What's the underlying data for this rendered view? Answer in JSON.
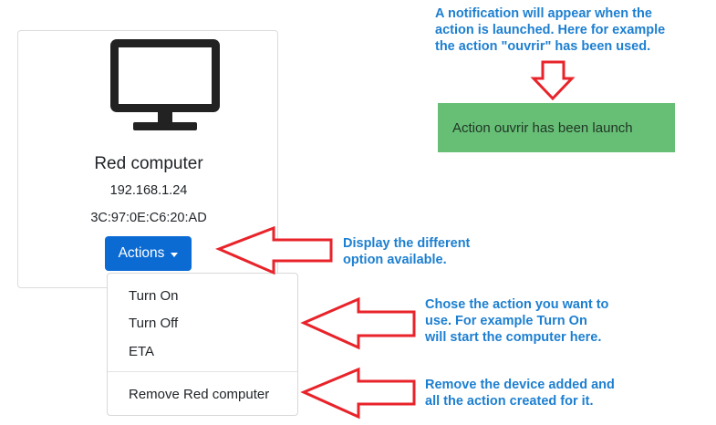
{
  "device_card": {
    "icon": "monitor-icon",
    "name": "Red computer",
    "ip": "192.168.1.24",
    "mac": "3C:97:0E:C6:20:AD",
    "actions_label": "Actions"
  },
  "dropdown": {
    "items": [
      "Turn On",
      "Turn Off",
      "ETA"
    ],
    "remove_label": "Remove Red computer"
  },
  "notification": {
    "text": "Action ouvrir has been launch",
    "color": "#67bf76"
  },
  "annotations": {
    "top_line1": "A notification will appear when the",
    "top_line2": "action is launched. Here for example",
    "top_line3": "the action \"ouvrir\" has been used.",
    "display_line1": "Display the different",
    "display_line2": "option available.",
    "chose_line1": "Chose the action you want to",
    "chose_line2": "use. For example Turn On",
    "chose_line3": "will start the computer here.",
    "remove_line1": "Remove the device added and",
    "remove_line2": "all the action created for it.",
    "text_color": "#1d7fd0",
    "arrow_color": "#e8232a"
  }
}
